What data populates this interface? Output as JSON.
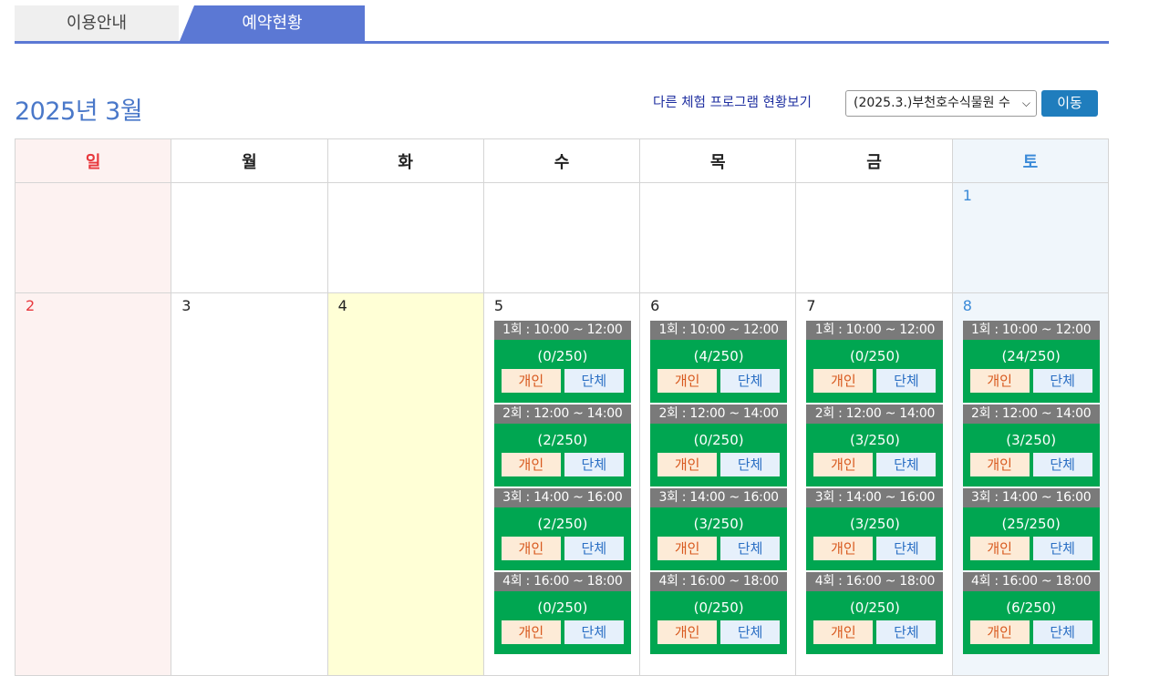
{
  "tabs": [
    {
      "label": "이용안내",
      "active": false
    },
    {
      "label": "예약현황",
      "active": true
    }
  ],
  "header": {
    "month_title": "2025년 3월",
    "other_label": "다른 체험 프로그램 현황보기",
    "select_value": "(2025.3.)부천호수식물원 수",
    "go_label": "이동"
  },
  "weekdays": [
    "일",
    "월",
    "화",
    "수",
    "목",
    "금",
    "토"
  ],
  "week1": {
    "sat": "1"
  },
  "week2": {
    "sun": "2",
    "mon": "3",
    "tue": "4",
    "wed": "5",
    "thu": "6",
    "fri": "7",
    "sat": "8"
  },
  "buttons": {
    "individual": "개인",
    "group": "단체"
  },
  "sessions": {
    "wed": [
      {
        "time": "1회 : 10:00 ~ 12:00",
        "count": "(0/250)"
      },
      {
        "time": "2회 : 12:00 ~ 14:00",
        "count": "(2/250)"
      },
      {
        "time": "3회 : 14:00 ~ 16:00",
        "count": "(2/250)"
      },
      {
        "time": "4회 : 16:00 ~ 18:00",
        "count": "(0/250)"
      }
    ],
    "thu": [
      {
        "time": "1회 : 10:00 ~ 12:00",
        "count": "(4/250)"
      },
      {
        "time": "2회 : 12:00 ~ 14:00",
        "count": "(0/250)"
      },
      {
        "time": "3회 : 14:00 ~ 16:00",
        "count": "(3/250)"
      },
      {
        "time": "4회 : 16:00 ~ 18:00",
        "count": "(0/250)"
      }
    ],
    "fri": [
      {
        "time": "1회 : 10:00 ~ 12:00",
        "count": "(0/250)"
      },
      {
        "time": "2회 : 12:00 ~ 14:00",
        "count": "(3/250)"
      },
      {
        "time": "3회 : 14:00 ~ 16:00",
        "count": "(3/250)"
      },
      {
        "time": "4회 : 16:00 ~ 18:00",
        "count": "(0/250)"
      }
    ],
    "sat": [
      {
        "time": "1회 : 10:00 ~ 12:00",
        "count": "(24/250)"
      },
      {
        "time": "2회 : 12:00 ~ 14:00",
        "count": "(3/250)"
      },
      {
        "time": "3회 : 14:00 ~ 16:00",
        "count": "(25/250)"
      },
      {
        "time": "4회 : 16:00 ~ 18:00",
        "count": "(6/250)"
      }
    ]
  },
  "colors": {
    "tab_active": "#5b78d4",
    "session_time_bg": "#7a7a7a",
    "session_body_bg": "#00a651",
    "today_bg": "#ffffd6",
    "sunday": "#e8383d",
    "saturday": "#3a8ad8",
    "go_button": "#1f7dbd"
  }
}
